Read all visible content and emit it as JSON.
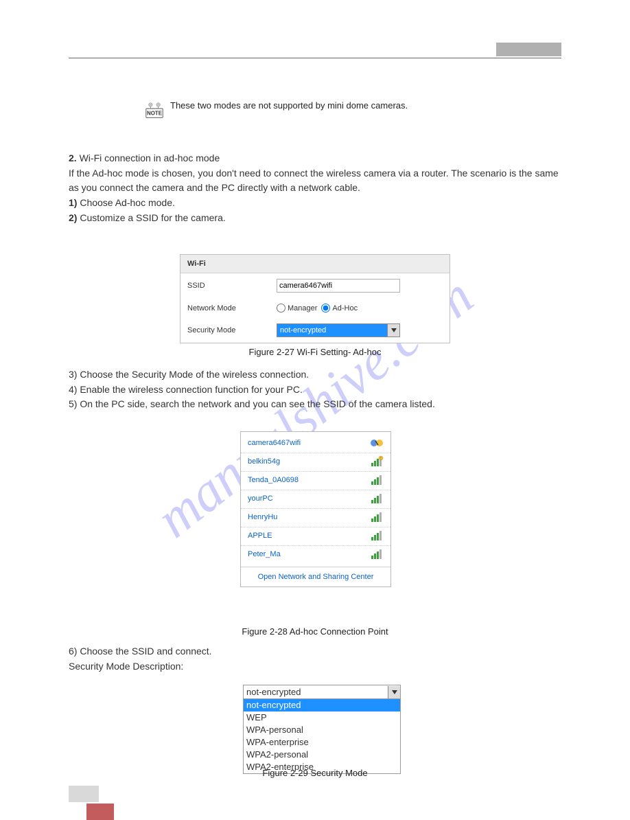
{
  "watermark": "manualshive.com",
  "note_icon_label": "NOTE",
  "note_text": "These two modes are not supported by mini dome cameras.",
  "step2_line1_prefix": "2.",
  "step2_line1": " Wi-Fi connection in ad-hoc mode",
  "step2_text": "If the Ad-hoc mode is chosen, you don't need to connect the wireless camera via a router. The scenario is the same as you connect the camera and the PC directly with a network cable.",
  "step2_sub1_prefix": "1)",
  "step2_sub1": " Choose Ad-hoc mode.",
  "step2_sub2_prefix": "2)",
  "step2_sub2": " Customize a SSID for the camera.",
  "wifi": {
    "header": "Wi-Fi",
    "ssid_label": "SSID",
    "ssid_value": "camera6467wifi",
    "network_mode_label": "Network Mode",
    "radio_manager": "Manager",
    "radio_adhoc": "Ad-Hoc",
    "security_mode_label": "Security Mode",
    "security_mode_value": "not-encrypted"
  },
  "caption1": "Figure 2-27 Wi-Fi Setting- Ad-hoc",
  "step2_sub3_prefix": "3)",
  "step2_sub3": " Choose the Security Mode of the wireless connection.",
  "step2_sub4_prefix": "4)",
  "step2_sub4": " Enable the wireless connection function for your PC.",
  "step2_sub5_prefix": "5)",
  "step2_sub5": " On the PC side, search the network and you can see the SSID of the camera listed.",
  "wireless_list": {
    "items": [
      {
        "name": "camera6467wifi",
        "status": "connected"
      },
      {
        "name": "belkin54g",
        "status": "signal-warning"
      },
      {
        "name": "Tenda_0A0698",
        "status": "signal"
      },
      {
        "name": "yourPC",
        "status": "signal"
      },
      {
        "name": "HenryHu",
        "status": "signal"
      },
      {
        "name": "APPLE",
        "status": "signal"
      },
      {
        "name": "Peter_Ma",
        "status": "signal"
      }
    ],
    "footer": "Open Network and Sharing Center"
  },
  "caption2": "Figure 2-28 Ad-hoc Connection Point",
  "step2_sub6_prefix": "6)",
  "step2_sub6": " Choose the SSID and connect.",
  "security_desc_title": "Security Mode Description:",
  "security_dropdown": {
    "selected": "not-encrypted",
    "options": [
      "not-encrypted",
      "WEP",
      "WPA-personal",
      "WPA-enterprise",
      "WPA2-personal",
      "WPA2-enterprise"
    ]
  },
  "caption3": "Figure 2-29 Security Mode"
}
